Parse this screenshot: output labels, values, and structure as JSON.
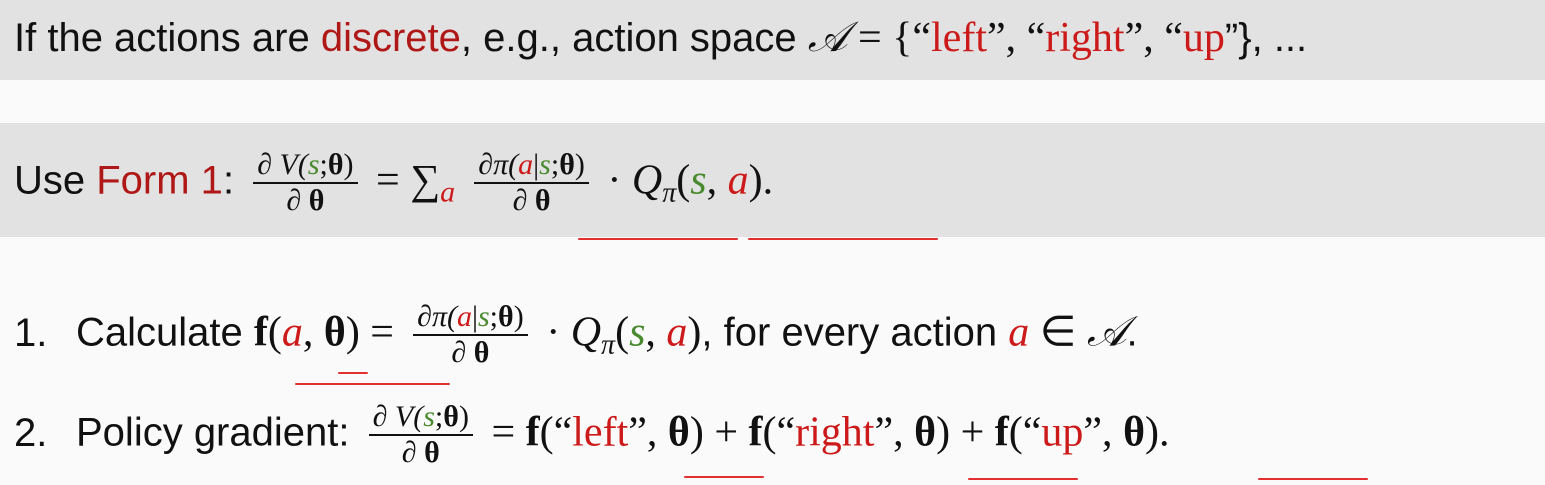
{
  "line1": {
    "prefix": "If the actions are ",
    "highlight": "discrete",
    "middle": ", e.g., action space ",
    "space_symbol": "𝒜",
    "equals": " = {“",
    "action_left": "left",
    "sep1": "”, “",
    "action_right": "right",
    "sep2": "”, “",
    "action_up": "up",
    "suffix": "”}, ..."
  },
  "line2": {
    "prefix": "Use ",
    "highlight": "Form 1",
    "colon": ":",
    "lhs_num_prefix": "∂ V(",
    "state": "s",
    "param_sep": ";",
    "theta": "θ",
    "close_paren": ")",
    "partial_theta_prefix": "∂ ",
    "equals": " = ∑",
    "sum_index": "a",
    "rhs_num_prefix": "∂π(",
    "action": "a",
    "given": "|",
    "dot": " · ",
    "q": "Q",
    "q_sub": "π",
    "open_paren": "(",
    "comma": ", ",
    "end": ")."
  },
  "item1": {
    "number": "1.",
    "label": "Calculate ",
    "f": "f",
    "open": "(",
    "action": "a",
    "comma": ", ",
    "theta": "θ",
    "close_eq": ") =",
    "tail": ",  for every action ",
    "member": " ∈ ",
    "space_symbol": "𝒜",
    "period": "."
  },
  "item2": {
    "number": "2.",
    "label": "Policy gradient: ",
    "eq": " = ",
    "term_left": "left",
    "term_right": "right",
    "term_up": "up",
    "plus": " + ",
    "open_q": "(“",
    "close_q": "”, ",
    "end": ")."
  },
  "colors": {
    "highlight_text": "#b01818",
    "action_text": "#cc1a1a",
    "state_text": "#4a8a2e",
    "band": "#e2e2e2",
    "annotation": "#e23030"
  }
}
